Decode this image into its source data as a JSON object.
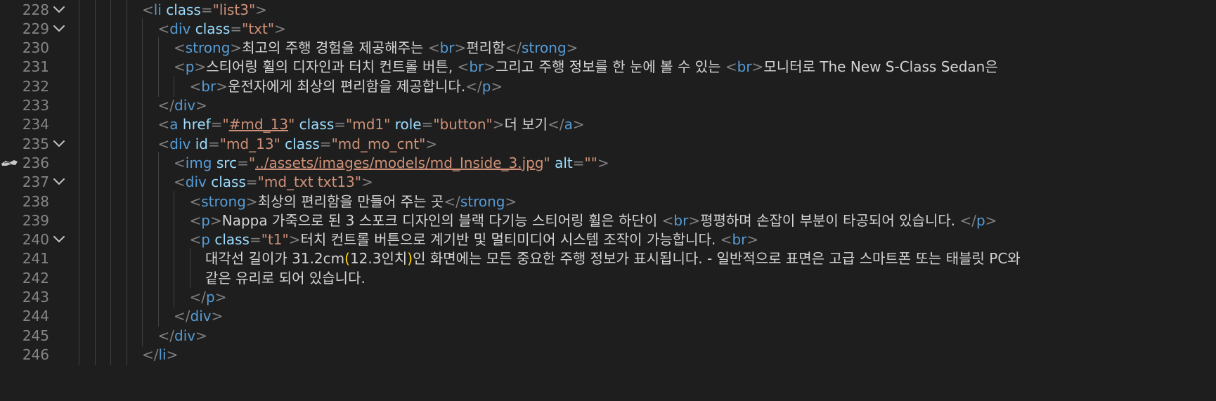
{
  "editor": {
    "language": "html",
    "lines": [
      {
        "n": "228",
        "fold": true,
        "indent": 4,
        "tokens": [
          [
            "p",
            "<"
          ],
          [
            "tag",
            "li"
          ],
          [
            "text",
            " "
          ],
          [
            "attr",
            "class"
          ],
          [
            "p",
            "="
          ],
          [
            "str",
            "\"list3\""
          ],
          [
            "p",
            ">"
          ]
        ]
      },
      {
        "n": "229",
        "fold": true,
        "indent": 5,
        "tokens": [
          [
            "p",
            "<"
          ],
          [
            "tag",
            "div"
          ],
          [
            "text",
            " "
          ],
          [
            "attr",
            "class"
          ],
          [
            "p",
            "="
          ],
          [
            "str",
            "\"txt\""
          ],
          [
            "p",
            ">"
          ]
        ]
      },
      {
        "n": "230",
        "fold": false,
        "indent": 6,
        "tokens": [
          [
            "p",
            "<"
          ],
          [
            "tag",
            "strong"
          ],
          [
            "p",
            ">"
          ],
          [
            "text",
            "최고의 주행 경험을 제공해주는 "
          ],
          [
            "p",
            "<"
          ],
          [
            "tag",
            "br"
          ],
          [
            "p",
            ">"
          ],
          [
            "text",
            "편리함"
          ],
          [
            "p",
            "</"
          ],
          [
            "tag",
            "strong"
          ],
          [
            "p",
            ">"
          ]
        ]
      },
      {
        "n": "231",
        "fold": false,
        "indent": 6,
        "tokens": [
          [
            "p",
            "<"
          ],
          [
            "tag",
            "p"
          ],
          [
            "p",
            ">"
          ],
          [
            "text",
            "스티어링 휠의 디자인과 터치 컨트롤 버튼, "
          ],
          [
            "p",
            "<"
          ],
          [
            "tag",
            "br"
          ],
          [
            "p",
            ">"
          ],
          [
            "text",
            "그리고 주행 정보를 한 눈에 볼 수 있는 "
          ],
          [
            "p",
            "<"
          ],
          [
            "tag",
            "br"
          ],
          [
            "p",
            ">"
          ],
          [
            "text",
            "모니터로 The New S-Class Sedan은"
          ]
        ]
      },
      {
        "n": "232",
        "fold": false,
        "indent": 7,
        "tokens": [
          [
            "p",
            "<"
          ],
          [
            "tag",
            "br"
          ],
          [
            "p",
            ">"
          ],
          [
            "text",
            "운전자에게 최상의 편리함을 제공합니다."
          ],
          [
            "p",
            "</"
          ],
          [
            "tag",
            "p"
          ],
          [
            "p",
            ">"
          ]
        ]
      },
      {
        "n": "233",
        "fold": false,
        "indent": 5,
        "tokens": [
          [
            "p",
            "</"
          ],
          [
            "tag",
            "div"
          ],
          [
            "p",
            ">"
          ]
        ]
      },
      {
        "n": "234",
        "fold": false,
        "indent": 5,
        "tokens": [
          [
            "p",
            "<"
          ],
          [
            "tag",
            "a"
          ],
          [
            "text",
            " "
          ],
          [
            "attr",
            "href"
          ],
          [
            "p",
            "="
          ],
          [
            "str",
            "\""
          ],
          [
            "link",
            "#md_13"
          ],
          [
            "str",
            "\""
          ],
          [
            "text",
            " "
          ],
          [
            "attr",
            "class"
          ],
          [
            "p",
            "="
          ],
          [
            "str",
            "\"md1\""
          ],
          [
            "text",
            " "
          ],
          [
            "attr",
            "role"
          ],
          [
            "p",
            "="
          ],
          [
            "str",
            "\"button\""
          ],
          [
            "p",
            ">"
          ],
          [
            "text",
            "더 보기"
          ],
          [
            "p",
            "</"
          ],
          [
            "tag",
            "a"
          ],
          [
            "p",
            ">"
          ]
        ]
      },
      {
        "n": "235",
        "fold": true,
        "indent": 5,
        "tokens": [
          [
            "p",
            "<"
          ],
          [
            "tag",
            "div"
          ],
          [
            "text",
            " "
          ],
          [
            "attr",
            "id"
          ],
          [
            "p",
            "="
          ],
          [
            "str",
            "\"md_13\""
          ],
          [
            "text",
            " "
          ],
          [
            "attr",
            "class"
          ],
          [
            "p",
            "="
          ],
          [
            "str",
            "\"md_mo_cnt\""
          ],
          [
            "p",
            ">"
          ]
        ]
      },
      {
        "n": "236",
        "fold": false,
        "indent": 6,
        "glyph": true,
        "tokens": [
          [
            "p",
            "<"
          ],
          [
            "tag",
            "img"
          ],
          [
            "text",
            " "
          ],
          [
            "attr",
            "src"
          ],
          [
            "p",
            "="
          ],
          [
            "str",
            "\""
          ],
          [
            "link",
            "../assets/images/models/md_Inside_3.jpg"
          ],
          [
            "str",
            "\""
          ],
          [
            "text",
            " "
          ],
          [
            "attr",
            "alt"
          ],
          [
            "p",
            "="
          ],
          [
            "str",
            "\"\""
          ],
          [
            "p",
            ">"
          ]
        ]
      },
      {
        "n": "237",
        "fold": true,
        "indent": 6,
        "tokens": [
          [
            "p",
            "<"
          ],
          [
            "tag",
            "div"
          ],
          [
            "text",
            " "
          ],
          [
            "attr",
            "class"
          ],
          [
            "p",
            "="
          ],
          [
            "str",
            "\"md_txt txt13\""
          ],
          [
            "p",
            ">"
          ]
        ]
      },
      {
        "n": "238",
        "fold": false,
        "indent": 7,
        "tokens": [
          [
            "p",
            "<"
          ],
          [
            "tag",
            "strong"
          ],
          [
            "p",
            ">"
          ],
          [
            "text",
            "최상의 편리함을 만들어 주는 곳"
          ],
          [
            "p",
            "</"
          ],
          [
            "tag",
            "strong"
          ],
          [
            "p",
            ">"
          ]
        ]
      },
      {
        "n": "239",
        "fold": false,
        "indent": 7,
        "tokens": [
          [
            "p",
            "<"
          ],
          [
            "tag",
            "p"
          ],
          [
            "p",
            ">"
          ],
          [
            "text",
            "Nappa 가죽으로 된 3 스포크 디자인의 블랙 다기능 스티어링 휠은 하단이 "
          ],
          [
            "p",
            "<"
          ],
          [
            "tag",
            "br"
          ],
          [
            "p",
            ">"
          ],
          [
            "text",
            "평평하며 손잡이 부분이 타공되어 있습니다. "
          ],
          [
            "p",
            "</"
          ],
          [
            "tag",
            "p"
          ],
          [
            "p",
            ">"
          ]
        ]
      },
      {
        "n": "240",
        "fold": true,
        "indent": 7,
        "tokens": [
          [
            "p",
            "<"
          ],
          [
            "tag",
            "p"
          ],
          [
            "text",
            " "
          ],
          [
            "attr",
            "class"
          ],
          [
            "p",
            "="
          ],
          [
            "str",
            "\"t1\""
          ],
          [
            "p",
            ">"
          ],
          [
            "text",
            "터치 컨트롤 버튼으로 계기반 및 멀티미디어 시스템 조작이 가능합니다. "
          ],
          [
            "p",
            "<"
          ],
          [
            "tag",
            "br"
          ],
          [
            "p",
            ">"
          ]
        ]
      },
      {
        "n": "241",
        "fold": false,
        "indent": 8,
        "tokens": [
          [
            "text",
            "대각선 길이가 31.2cm"
          ],
          [
            "brk",
            "("
          ],
          [
            "text",
            "12.3인치"
          ],
          [
            "brk",
            ")"
          ],
          [
            "text",
            "인 화면에는 모든 중요한 주행 정보가 표시됩니다. - 일반적으로 표면은 고급 스마트폰 또는 태블릿 PC와"
          ]
        ]
      },
      {
        "n": "242",
        "fold": false,
        "indent": 8,
        "tokens": [
          [
            "text",
            "같은 유리로 되어 있습니다."
          ]
        ]
      },
      {
        "n": "243",
        "fold": false,
        "indent": 7,
        "tokens": [
          [
            "p",
            "</"
          ],
          [
            "tag",
            "p"
          ],
          [
            "p",
            ">"
          ]
        ]
      },
      {
        "n": "244",
        "fold": false,
        "indent": 6,
        "tokens": [
          [
            "p",
            "</"
          ],
          [
            "tag",
            "div"
          ],
          [
            "p",
            ">"
          ]
        ]
      },
      {
        "n": "245",
        "fold": false,
        "indent": 5,
        "tokens": [
          [
            "p",
            "</"
          ],
          [
            "tag",
            "div"
          ],
          [
            "p",
            ">"
          ]
        ]
      },
      {
        "n": "246",
        "fold": false,
        "indent": 4,
        "tokens": [
          [
            "p",
            "</"
          ],
          [
            "tag",
            "li"
          ],
          [
            "p",
            ">"
          ]
        ]
      }
    ]
  },
  "icons": {
    "fold": "chevron-down-icon",
    "gutter_glyph": "breakpoint-glyph-icon"
  },
  "colors": {
    "background": "#1e1e1e",
    "line_number": "#858585",
    "punctuation": "#808080",
    "tag": "#569cd6",
    "attribute": "#9cdcfe",
    "string": "#ce9178",
    "text": "#d4d4d4",
    "bracket": "#ffd700",
    "indent_guide": "#404040"
  }
}
